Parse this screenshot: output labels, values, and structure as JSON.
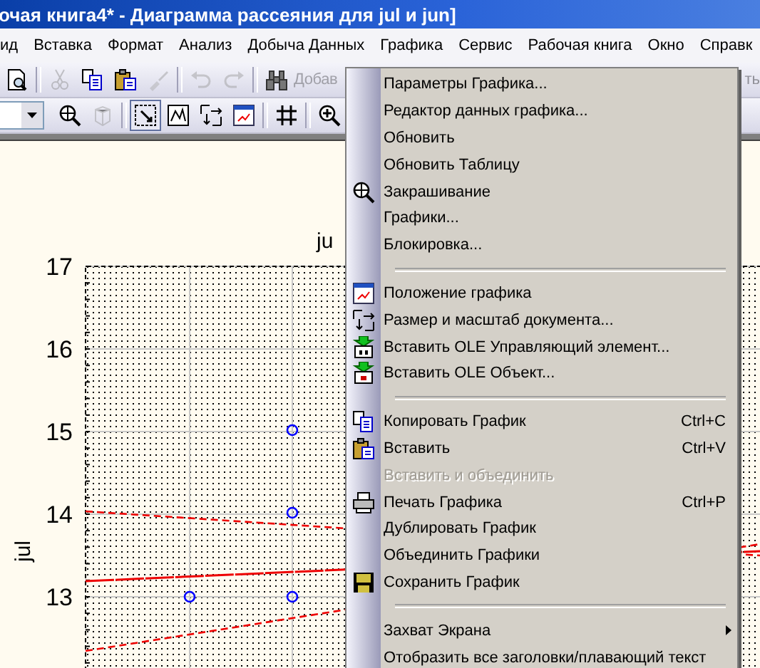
{
  "window": {
    "title": "очая книга4* - Диаграмма рассеяния для jul и jun]"
  },
  "menubar": [
    "ид",
    "Вставка",
    "Формат",
    "Анализ",
    "Добыча Данных",
    "Графика",
    "Сервис",
    "Рабочая книга",
    "Окно",
    "Справк"
  ],
  "toolbar_1": {
    "items": [
      {
        "kind": "button",
        "disabled": false
      },
      {
        "kind": "separator"
      },
      {
        "kind": "button",
        "disabled": true
      },
      {
        "kind": "button",
        "disabled": false
      },
      {
        "kind": "button",
        "disabled": false
      },
      {
        "kind": "button",
        "disabled": true
      },
      {
        "kind": "separator"
      },
      {
        "kind": "button",
        "disabled": true
      },
      {
        "kind": "button",
        "disabled": true
      },
      {
        "kind": "separator"
      },
      {
        "kind": "button",
        "disabled": false
      },
      {
        "kind": "label",
        "text": "Добав",
        "disabled": true
      }
    ],
    "right_text": "ть"
  },
  "toolbar_2": {
    "items": [
      {
        "kind": "dropdown"
      },
      {
        "kind": "button",
        "selected": false,
        "disabled": false
      },
      {
        "kind": "button",
        "selected": false,
        "disabled": true
      },
      {
        "kind": "separator"
      },
      {
        "kind": "button",
        "selected": true,
        "disabled": false
      },
      {
        "kind": "button",
        "selected": false,
        "disabled": false
      },
      {
        "kind": "button",
        "selected": false,
        "disabled": false
      },
      {
        "kind": "button",
        "selected": false,
        "disabled": false
      },
      {
        "kind": "separator"
      },
      {
        "kind": "button",
        "selected": false,
        "disabled": false
      },
      {
        "kind": "separator"
      },
      {
        "kind": "button",
        "selected": false,
        "disabled": false
      }
    ]
  },
  "chart": {
    "title": "ju",
    "y_axis_label": "jul",
    "y_ticks": [
      "17",
      "16",
      "15",
      "14",
      "13"
    ]
  },
  "context_menu": {
    "items": [
      {
        "kind": "item",
        "label": "Параметры Графика...",
        "disabled": false
      },
      {
        "kind": "item",
        "label": "Редактор данных графика...",
        "disabled": false
      },
      {
        "kind": "item",
        "label": "Обновить",
        "disabled": false
      },
      {
        "kind": "item",
        "label": "Обновить Таблицу",
        "disabled": false
      },
      {
        "kind": "item",
        "label": "Закрашивание",
        "disabled": false
      },
      {
        "kind": "item",
        "label": "Графики...",
        "disabled": false
      },
      {
        "kind": "item",
        "label": "Блокировка...",
        "disabled": false
      },
      {
        "kind": "separator"
      },
      {
        "kind": "item",
        "label": "Положение графика",
        "disabled": false
      },
      {
        "kind": "item",
        "label": "Размер и масштаб документа...",
        "disabled": false
      },
      {
        "kind": "item",
        "label": "Вставить OLE Управляющий элемент...",
        "disabled": false
      },
      {
        "kind": "item",
        "label": "Вставить OLE Объект...",
        "disabled": false
      },
      {
        "kind": "separator"
      },
      {
        "kind": "item",
        "label": "Копировать График",
        "shortcut": "Ctrl+C",
        "disabled": false
      },
      {
        "kind": "item",
        "label": "Вставить",
        "shortcut": "Ctrl+V",
        "disabled": false
      },
      {
        "kind": "item",
        "label": "Вставить и объединить",
        "disabled": true
      },
      {
        "kind": "item",
        "label": "Печать Графика",
        "shortcut": "Ctrl+P",
        "disabled": false
      },
      {
        "kind": "item",
        "label": "Дублировать График",
        "disabled": false
      },
      {
        "kind": "item",
        "label": "Объединить Графики",
        "disabled": false
      },
      {
        "kind": "item",
        "label": "Сохранить График",
        "disabled": false
      },
      {
        "kind": "separator"
      },
      {
        "kind": "item",
        "label": "Захват Экрана",
        "submenu": true,
        "disabled": false
      },
      {
        "kind": "item",
        "label": "Отобразить все заголовки/плавающий текст",
        "disabled": false
      }
    ]
  }
}
